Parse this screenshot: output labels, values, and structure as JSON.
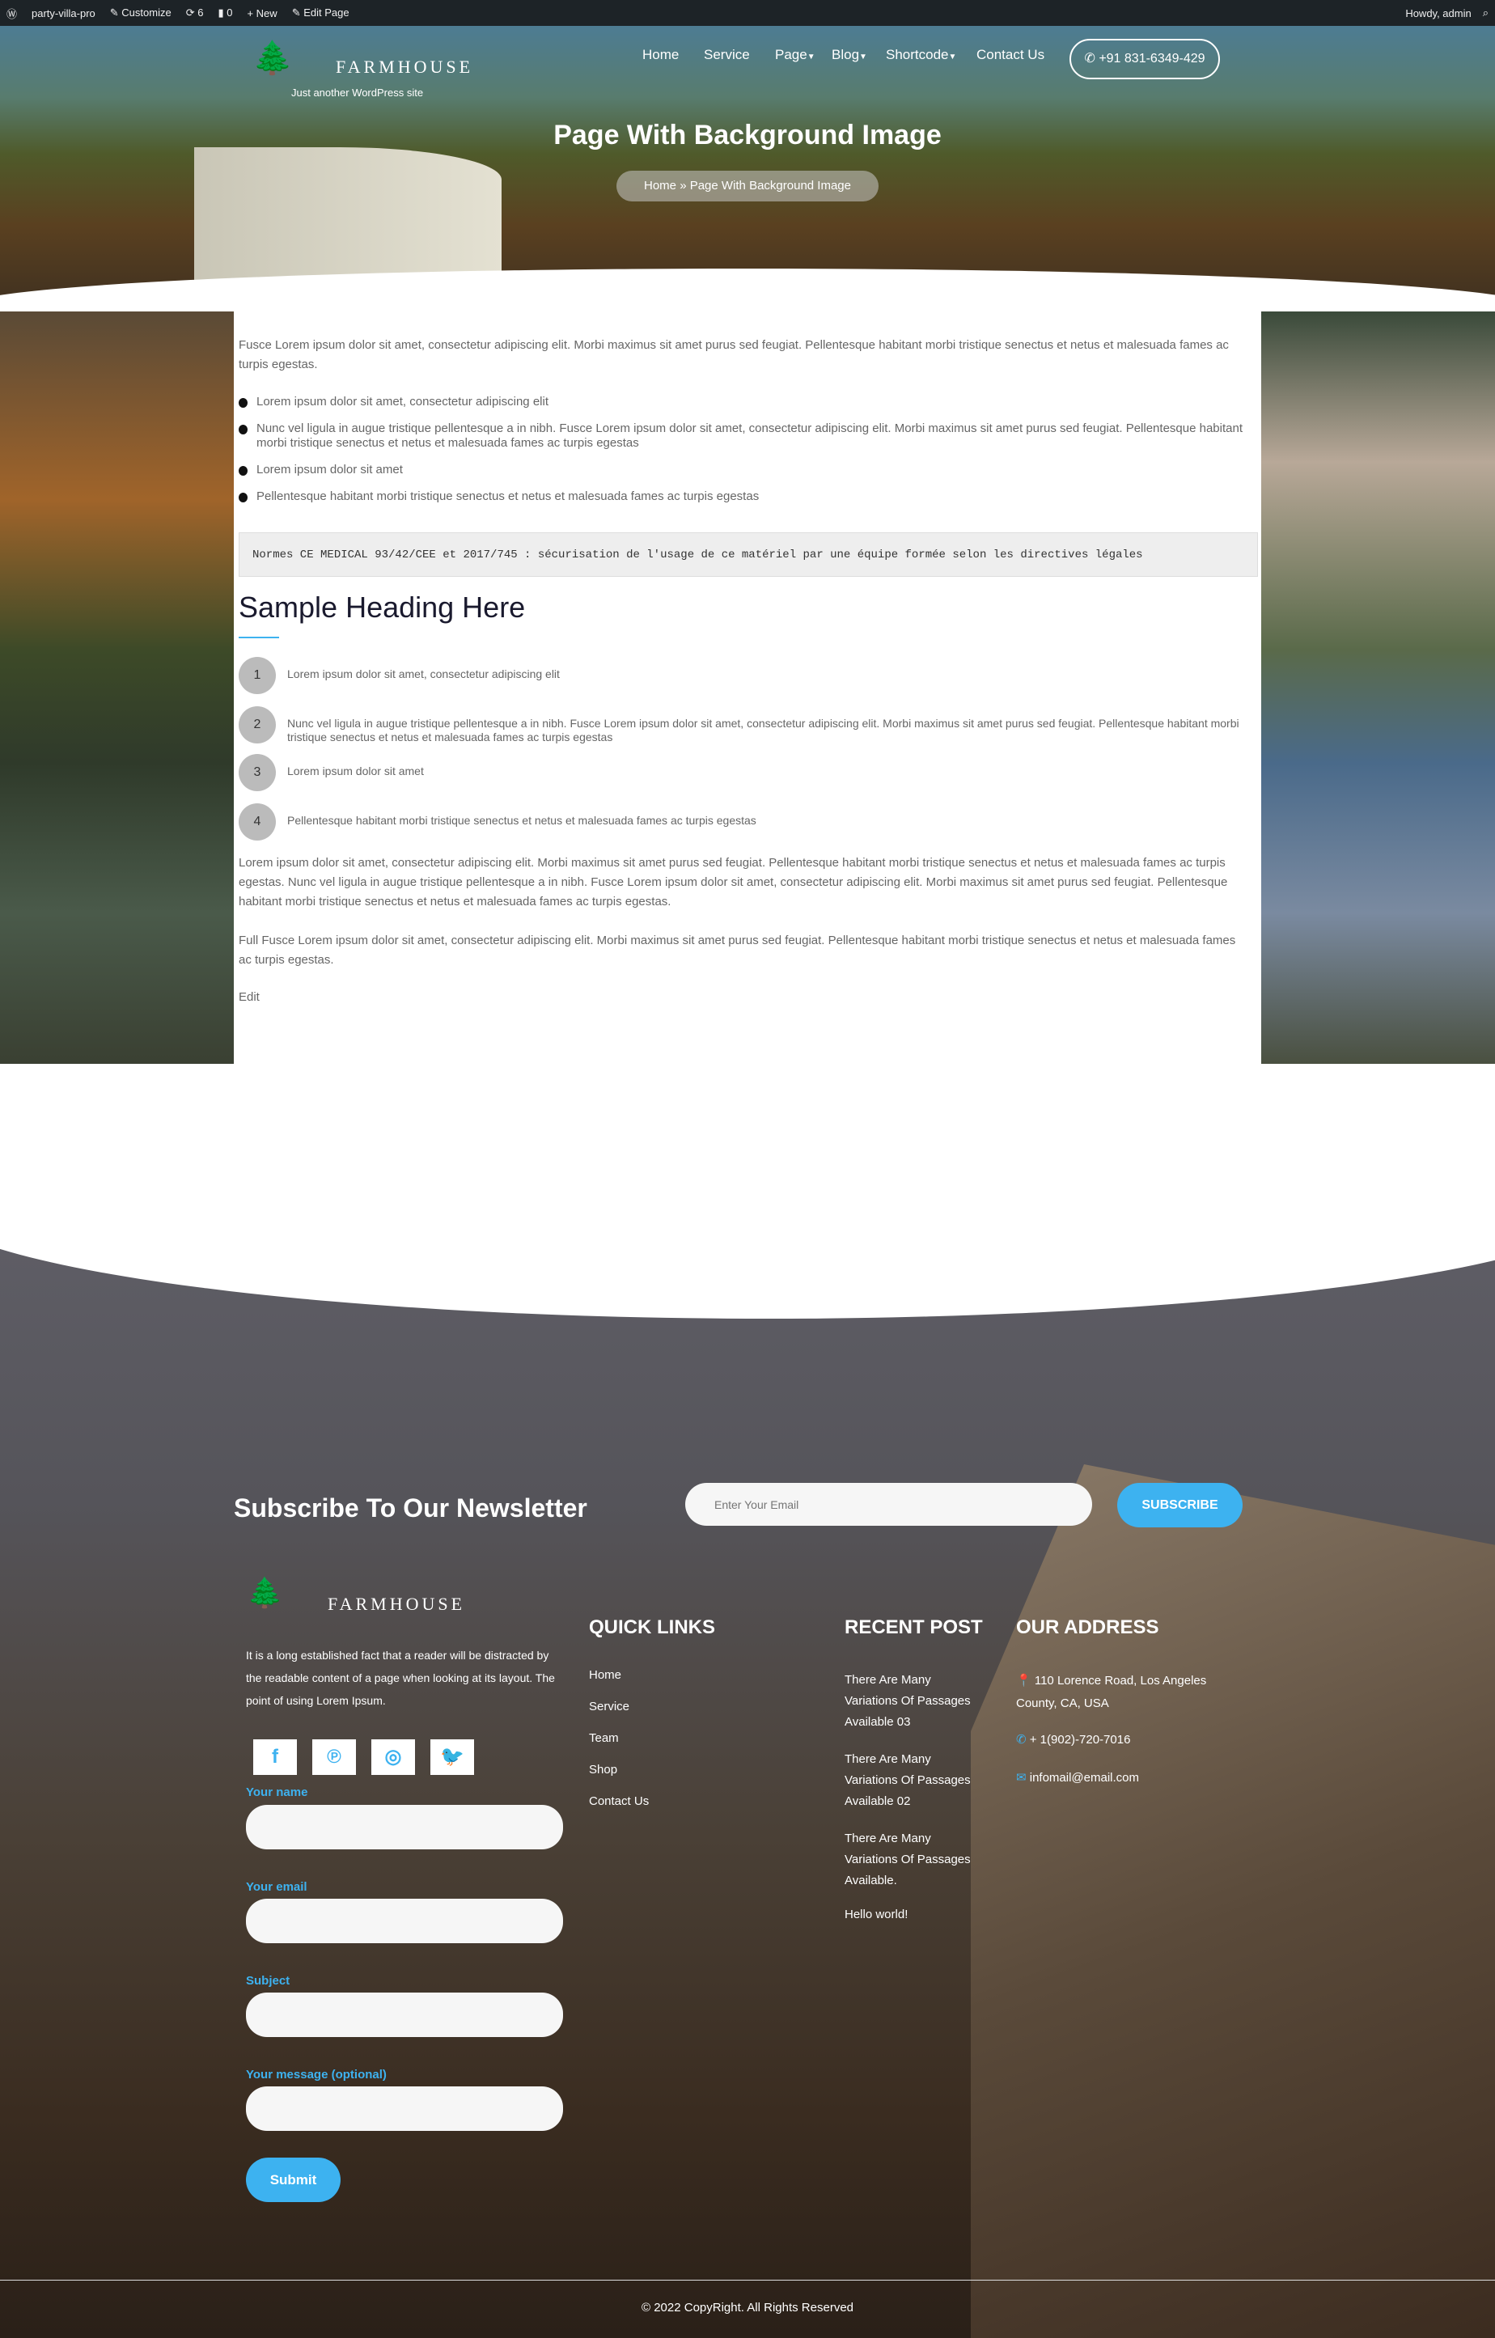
{
  "adminbar": {
    "site": "party-villa-pro",
    "customize": "Customize",
    "updates": "6",
    "comments": "0",
    "new": "New",
    "edit": "Edit Page",
    "howdy": "Howdy, admin"
  },
  "header": {
    "logo": "FARMHOUSE",
    "tagline": "Just another WordPress site",
    "nav": [
      "Home",
      "Service",
      "Page",
      "Blog",
      "Shortcode",
      "Contact Us"
    ],
    "phone": "+91 831-6349-429",
    "title": "Page With Background Image",
    "breadcrumb": {
      "home": "Home",
      "sep": "»",
      "current": "Page With Background Image"
    }
  },
  "content": {
    "intro": "Fusce Lorem ipsum dolor sit amet, consectetur adipiscing elit. Morbi maximus sit amet purus sed feugiat. Pellentesque habitant morbi tristique senectus et netus et malesuada fames ac turpis egestas.",
    "bullets": [
      "Lorem ipsum dolor sit amet, consectetur adipiscing elit",
      "Nunc vel ligula in augue tristique pellentesque a in nibh. Fusce Lorem ipsum dolor sit amet, consectetur adipiscing elit. Morbi maximus sit amet purus sed feugiat. Pellentesque habitant morbi tristique senectus et netus et malesuada fames ac turpis egestas",
      "Lorem ipsum dolor sit amet",
      "Pellentesque habitant morbi tristique senectus et netus et malesuada fames ac turpis egestas"
    ],
    "code": "Normes CE MEDICAL 93/42/CEE et 2017/745 : sécurisation de l'usage de ce matériel par une équipe formée selon les directives légales",
    "heading": "Sample Heading Here",
    "ordered": [
      {
        "n": "1",
        "text": "Lorem ipsum dolor sit amet, consectetur adipiscing elit"
      },
      {
        "n": "2",
        "text": "Nunc vel ligula in augue tristique pellentesque a in nibh. Fusce Lorem ipsum dolor sit amet, consectetur adipiscing elit. Morbi maximus sit amet purus sed feugiat. Pellentesque habitant morbi tristique senectus et netus et malesuada fames ac turpis egestas"
      },
      {
        "n": "3",
        "text": "Lorem ipsum dolor sit amet"
      },
      {
        "n": "4",
        "text": "Pellentesque habitant morbi tristique senectus et netus et malesuada fames ac turpis egestas"
      }
    ],
    "para1": "Lorem ipsum dolor sit amet, consectetur adipiscing elit. Morbi maximus sit amet purus sed feugiat. Pellentesque habitant morbi tristique senectus et netus et malesuada fames ac turpis egestas. Nunc vel ligula in augue tristique pellentesque a in nibh. Fusce Lorem ipsum dolor sit amet, consectetur adipiscing elit. Morbi maximus sit amet purus sed feugiat. Pellentesque habitant morbi tristique senectus et netus et malesuada fames ac turpis egestas.",
    "para2": "Full Fusce Lorem ipsum dolor sit amet, consectetur adipiscing elit. Morbi maximus sit amet purus sed feugiat. Pellentesque habitant morbi tristique senectus et netus et malesuada fames ac turpis egestas.",
    "edit": "Edit"
  },
  "footer": {
    "newsletter_title": "Subscribe To Our Newsletter",
    "email_placeholder": "Enter Your Email",
    "subscribe": "SUBSCRIBE",
    "logo": "FARMHOUSE",
    "about": "It is a long established fact that a reader will be distracted by the readable content of a page when looking at its layout. The point of using Lorem Ipsum.",
    "social": [
      "facebook-icon",
      "pinterest-icon",
      "instagram-icon",
      "twitter-icon"
    ],
    "form": {
      "name": "Your name",
      "email": "Your email",
      "subject": "Subject",
      "message": "Your message (optional)",
      "submit": "Submit"
    },
    "quick_title": "QUICK LINKS",
    "quick": [
      "Home",
      "Service",
      "Team",
      "Shop",
      "Contact Us"
    ],
    "recent_title": "RECENT POST",
    "recent": [
      "There Are Many Variations Of Passages Available 03",
      "There Are Many Variations Of Passages Available 02",
      "There Are Many Variations Of Passages Available.",
      "Hello world!"
    ],
    "address_title": "OUR ADDRESS",
    "address": "110 Lorence Road, Los Angeles County, CA, USA",
    "phone": "+ 1(902)-720-7016",
    "email": "infomail@email.com",
    "copyright": "© 2022 CopyRight. All Rights Reserved"
  },
  "colors": {
    "accent": "#3db2f0",
    "adminbar": "#1d2327"
  }
}
